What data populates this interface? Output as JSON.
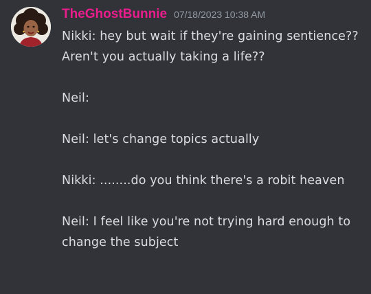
{
  "message": {
    "username": "TheGhostBunnie",
    "timestamp": "07/18/2023 10:38 AM",
    "username_color": "#e91e8c",
    "avatar_icon": "user-avatar-icon",
    "lines": [
      "Nikki: hey but wait if they're gaining sentience?? Aren't you actually taking a life??",
      "",
      "Neil:",
      "",
      "Neil: let's change topics actually",
      "",
      "Nikki: ........do you think there's a robit heaven",
      "",
      "Neil: I feel like you're not trying hard enough to change the subject"
    ]
  }
}
